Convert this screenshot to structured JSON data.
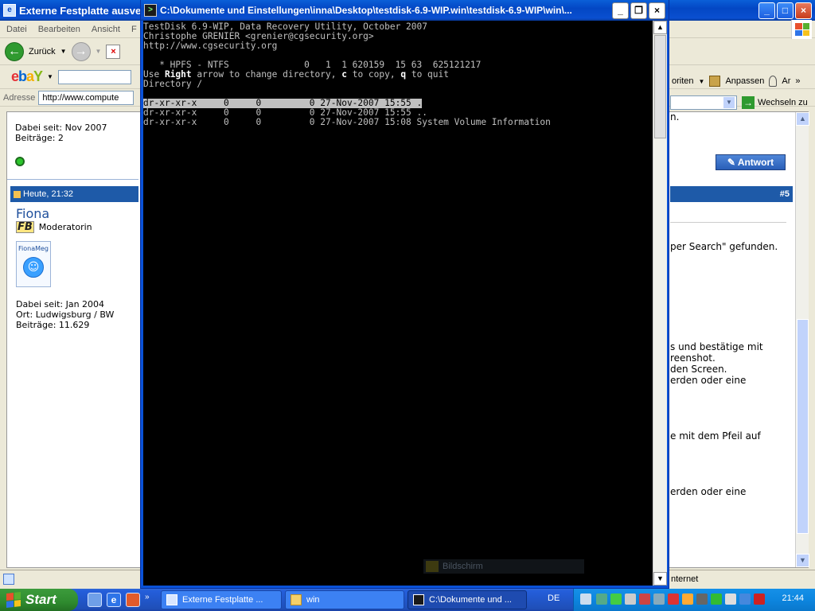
{
  "browser": {
    "title": "Externe Festplatte ausve",
    "menu": [
      "Datei",
      "Bearbeiten",
      "Ansicht",
      "F"
    ],
    "back_label": "Zurück",
    "address_label": "Adresse",
    "address_value": "http://www.compute",
    "favorites_fragment": "oriten",
    "customize_label": "Anpassen",
    "ar_fragment": "Ar",
    "go_label": "Wechseln zu",
    "status_fragment": "nternet"
  },
  "forum": {
    "prev_member_since": "Dabei seit: Nov 2007",
    "prev_posts": "Beiträge: 2",
    "post_time": "Heute, 21:32",
    "post_number": "#5",
    "username": "Fiona",
    "role": "Moderatorin",
    "avatar_caption": "FionaMeg",
    "member_since": "Dabei seit: Jan 2004",
    "location": "Ort: Ludwigsburg / BW",
    "posts": "Beiträge: 11.629",
    "reply_label": "Antwort",
    "fragments": {
      "f1": "n.",
      "f2": "per Search\" gefunden.",
      "f3": "s und bestätige mit",
      "f4": "reenshot.",
      "f5": "den Screen.",
      "f6": "erden oder eine",
      "f7": "e mit dem Pfeil auf",
      "f8": "erden oder eine"
    }
  },
  "console": {
    "title": "C:\\Dokumente und Einstellungen\\inna\\Desktop\\testdisk-6.9-WIP.win\\testdisk-6.9-WIP\\win\\...",
    "lines": {
      "l1": "TestDisk 6.9-WIP, Data Recovery Utility, October 2007",
      "l2": "Christophe GRENIER <grenier@cgsecurity.org>",
      "l3": "http://www.cgsecurity.org",
      "l4": "   * HPFS - NTFS              0   1  1 620159  15 63  625121217",
      "l5a": "Use ",
      "l5b": "Right",
      "l5c": " arrow to change directory, ",
      "l5d": "c",
      "l5e": " to copy, ",
      "l5f": "q",
      "l5g": " to quit",
      "l6": "Directory /",
      "r1": "dr-xr-xr-x     0     0         0 27-Nov-2007 15:55 .",
      "r2": "dr-xr-xr-x     0     0         0 27-Nov-2007 15:55 ..",
      "r3": "dr-xr-xr-x     0     0         0 27-Nov-2007 15:08 System Volume Information"
    },
    "ghost_label": "Bildschirm"
  },
  "taskbar": {
    "start_label": "Start",
    "tasks": {
      "t1": "Externe Festplatte ...",
      "t2": "win",
      "t3": "C:\\Dokumente und ..."
    },
    "language": "DE",
    "clock": "21:44"
  }
}
